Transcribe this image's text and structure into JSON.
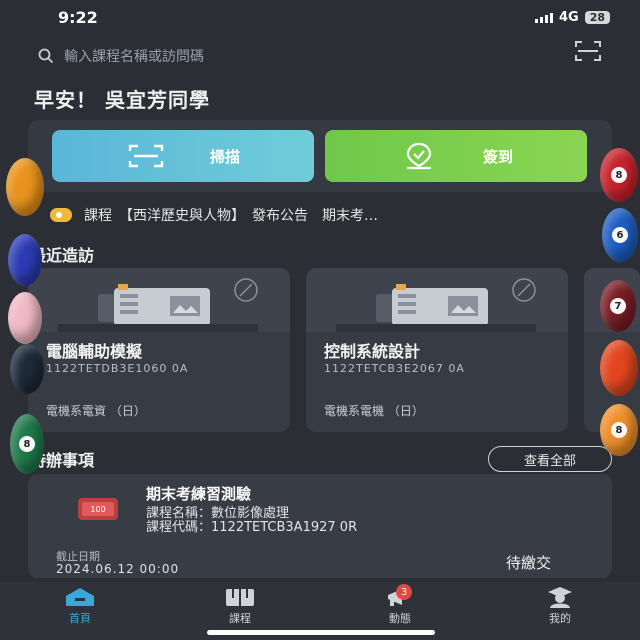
{
  "status": {
    "time": "9:22",
    "network": "4G",
    "battery": "28"
  },
  "search": {
    "placeholder": "輸入課程名稱或訪問碼"
  },
  "greeting": "早安！ 吳宜芳同學",
  "actions": {
    "scan_label": "掃描",
    "sign_label": "簽到"
  },
  "announcement": {
    "text": "課程　【西洋歷史與人物】　發布公告　期末考…"
  },
  "recent": {
    "title": "最近造訪",
    "courses": [
      {
        "name": "電腦輔助模擬",
        "code": "1122TETDB3E1060 0A",
        "dept": "電機系電資 （日）"
      },
      {
        "name": "控制系統設計",
        "code": "1122TETCB3E2067 0A",
        "dept": "電機系電機 （日）"
      }
    ]
  },
  "todo": {
    "title": "待辦事項",
    "view_all": "查看全部",
    "item": {
      "title": "期末考練習測驗",
      "course_name": "課程名稱：數位影像處理",
      "course_code": "課程代碼：1122TETCB3A1927 0R",
      "deadline_label": "截止日期",
      "deadline_value": "2024.06.12 00:00",
      "status": "待繳交"
    }
  },
  "tabs": [
    {
      "label": "首頁",
      "icon": "home-icon",
      "active": true
    },
    {
      "label": "課程",
      "icon": "book-icon",
      "active": false
    },
    {
      "label": "動態",
      "icon": "megaphone-icon",
      "active": false,
      "badge": "3"
    },
    {
      "label": "我的",
      "icon": "graduate-icon",
      "active": false
    }
  ],
  "colors": {
    "accent": "#39a8d8",
    "scan": "#5ab6d8",
    "sign": "#6fc84a",
    "badge": "#e04848"
  },
  "decorations": {
    "left_balls": [
      "",
      "",
      "",
      "",
      "8"
    ],
    "right_balls": [
      "8",
      "6",
      "7",
      "",
      "8"
    ]
  }
}
